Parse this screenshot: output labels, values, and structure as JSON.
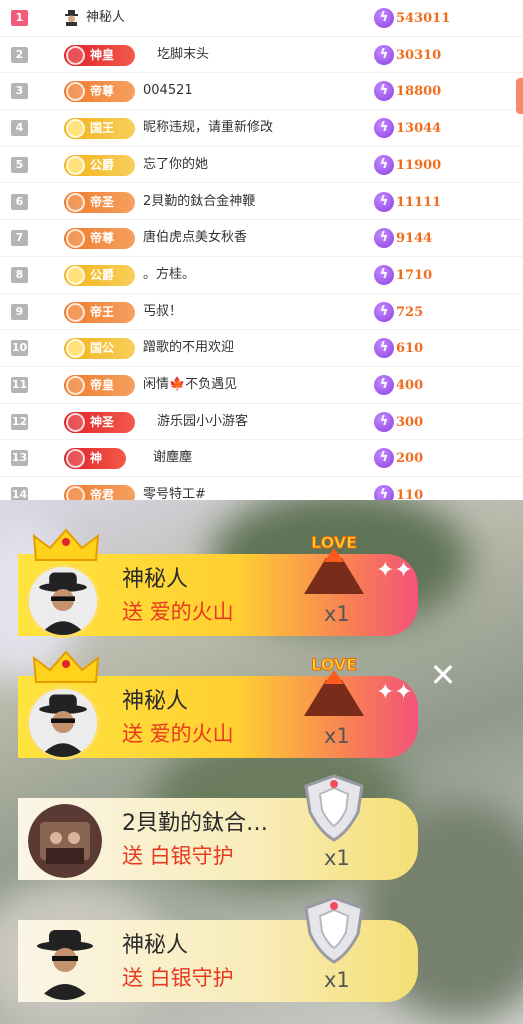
{
  "leaderboard": {
    "rows": [
      {
        "rank": "1",
        "badge": "",
        "name": "神秘人",
        "score": "543011"
      },
      {
        "rank": "2",
        "badge": "神皇",
        "name": "圪脚末头",
        "score": "30310"
      },
      {
        "rank": "3",
        "badge": "帝尊",
        "name": "004521",
        "score": "18800"
      },
      {
        "rank": "4",
        "badge": "国王",
        "name": "昵称违规，请重新修改",
        "score": "13044"
      },
      {
        "rank": "5",
        "badge": "公爵",
        "name": "忘了你的她",
        "score": "11900"
      },
      {
        "rank": "6",
        "badge": "帝圣",
        "name": "2貝勤的鈦合金神鞭",
        "score": "11111"
      },
      {
        "rank": "7",
        "badge": "帝尊",
        "name": "唐伯虎点美女秋香",
        "score": "9144"
      },
      {
        "rank": "8",
        "badge": "公爵",
        "name": "。方桂。",
        "score": "1710"
      },
      {
        "rank": "9",
        "badge": "帝王",
        "name": "丐叔！",
        "score": "725"
      },
      {
        "rank": "10",
        "badge": "国公",
        "name": "蹭歌的不用欢迎",
        "score": "610"
      },
      {
        "rank": "11",
        "badge": "帝皇",
        "name": "闲情🍁不负遇见",
        "score": "400"
      },
      {
        "rank": "12",
        "badge": "神圣",
        "name": "游乐园小小游客",
        "score": "300"
      },
      {
        "rank": "13",
        "badge": "神",
        "name": "谢塵塵",
        "score": "200"
      },
      {
        "rank": "14",
        "badge": "帝君",
        "name": "零号特工#",
        "score": "110"
      }
    ],
    "colors": {
      "score": "#ef6d1d",
      "rank_top": "#f25c7a",
      "rank": "#b5b5b5"
    }
  },
  "gifts": [
    {
      "sender": "神秘人",
      "action": "送 爱的火山",
      "count": "x1",
      "gift_icon": "love-volcano-icon"
    },
    {
      "sender": "神秘人",
      "action": "送 爱的火山",
      "count": "x1",
      "gift_icon": "love-volcano-icon"
    },
    {
      "sender": "2貝勤的鈦合…",
      "action": "送 白银守护",
      "count": "x1",
      "gift_icon": "silver-shield-icon"
    },
    {
      "sender": "神秘人",
      "action": "送 白银守护",
      "count": "x1",
      "gift_icon": "silver-shield-icon"
    }
  ],
  "close_label": "✕"
}
